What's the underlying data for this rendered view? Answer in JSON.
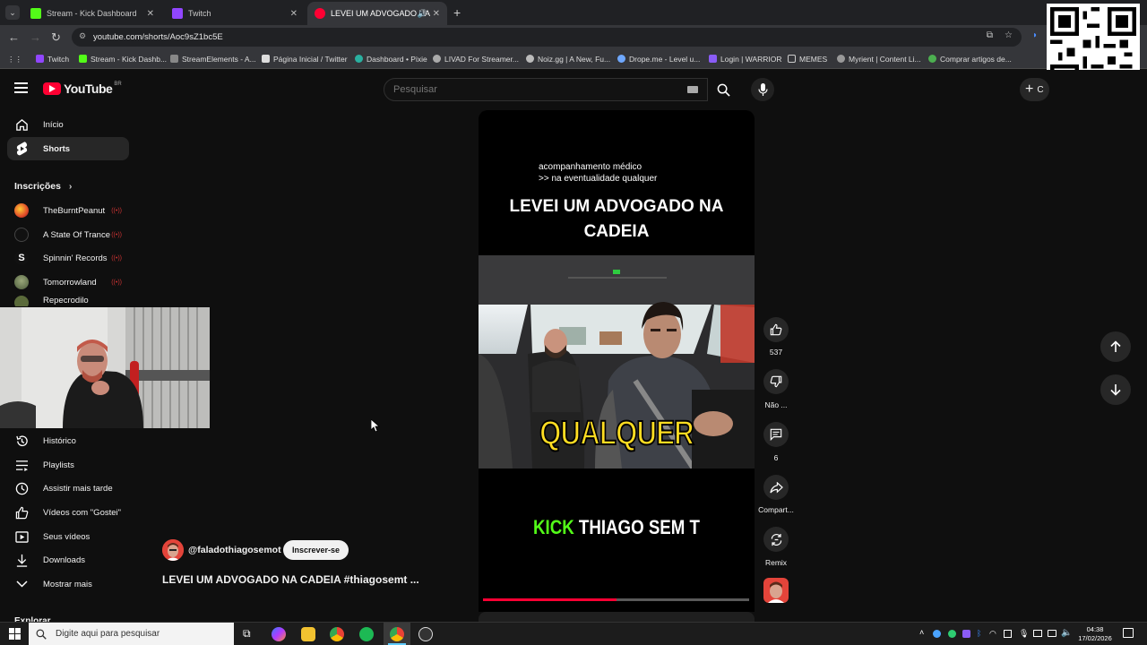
{
  "tabs": [
    {
      "title": "Stream - Kick Dashboard",
      "favicon_color": "#53fc18"
    },
    {
      "title": "Twitch",
      "favicon_color": "#9146ff"
    },
    {
      "title": "LEVEI UM ADVOGADO NA",
      "favicon_color": "#ff0033"
    }
  ],
  "address": {
    "url": "youtube.com/shorts/Aoc9sZ1bc5E"
  },
  "bookmarks": [
    {
      "label": "Twitch",
      "color": "#9146ff"
    },
    {
      "label": "Stream - Kick Dashb...",
      "color": "#53fc18"
    },
    {
      "label": "StreamElements - A...",
      "color": "#888888"
    },
    {
      "label": "Página Inicial / Twitter",
      "color": "#dddddd"
    },
    {
      "label": "Dashboard • Pixie",
      "color": "#2ab0a0"
    },
    {
      "label": "LIVAD For Streamer...",
      "color": "#aaaaaa"
    },
    {
      "label": "Noiz.gg | A New, Fu...",
      "color": "#bbbbbb"
    },
    {
      "label": "Drope.me - Level u...",
      "color": "#6fa8ff"
    },
    {
      "label": "Login | WARRIOR",
      "color": "#8a5cf6"
    },
    {
      "label": "MEMES",
      "color": "#cccccc"
    },
    {
      "label": "Myrient | Content Li...",
      "color": "#999999"
    },
    {
      "label": "Comprar artigos de...",
      "color": "#4caf50"
    }
  ],
  "youtube": {
    "logo_text": "YouTube",
    "region": "BR",
    "search_placeholder": "Pesquisar",
    "create_label": "C"
  },
  "sidebar": {
    "top": [
      {
        "label": "Início",
        "icon": "home-icon"
      },
      {
        "label": "Shorts",
        "icon": "shorts-icon"
      }
    ],
    "subscriptions_title": "Inscrições",
    "subscriptions": [
      {
        "name": "TheBurntPeanut",
        "color": "#e04a2a"
      },
      {
        "name": "A State Of Trance",
        "color": "#222222"
      },
      {
        "name": "Spinnin' Records",
        "color": "#111111"
      },
      {
        "name": "Tomorrowland",
        "color": "#6b7a4a"
      },
      {
        "name": "Repecrodilo",
        "color": "#5a6a3a"
      }
    ],
    "you": [
      {
        "label": "Histórico",
        "icon": "history-icon"
      },
      {
        "label": "Playlists",
        "icon": "playlist-icon"
      },
      {
        "label": "Assistir mais tarde",
        "icon": "clock-icon"
      },
      {
        "label": "Vídeos com \"Gostei\"",
        "icon": "thumbs-up-icon"
      },
      {
        "label": "Seus vídeos",
        "icon": "video-icon"
      },
      {
        "label": "Downloads",
        "icon": "download-icon"
      },
      {
        "label": "Mostrar mais",
        "icon": "chevron-down-icon"
      }
    ],
    "explore": "Explorar"
  },
  "video": {
    "top_caption_line1": "acompanhamento médico",
    "top_caption_line2": ">> na eventualidade qualquer",
    "headline": "LEVEI UM ADVOGADO NA CADEIA",
    "subtitle_word": "QUALQUER",
    "watermark_brand": "KICK",
    "watermark_name": "THIAGO SEM T",
    "progress": 0.5
  },
  "channel": {
    "handle": "@faladothiagosemot",
    "subscribe_label": "Inscrever-se",
    "title": "LEVEI UM ADVOGADO NA CADEIA #thiagosemt ..."
  },
  "actions": {
    "likes": "537",
    "dislike_label": "Não ...",
    "comments": "6",
    "share_label": "Compart...",
    "remix_label": "Remix"
  },
  "taskbar": {
    "search_placeholder": "Digite aqui para pesquisar",
    "time": "04:38",
    "date": "17/02/2026"
  }
}
